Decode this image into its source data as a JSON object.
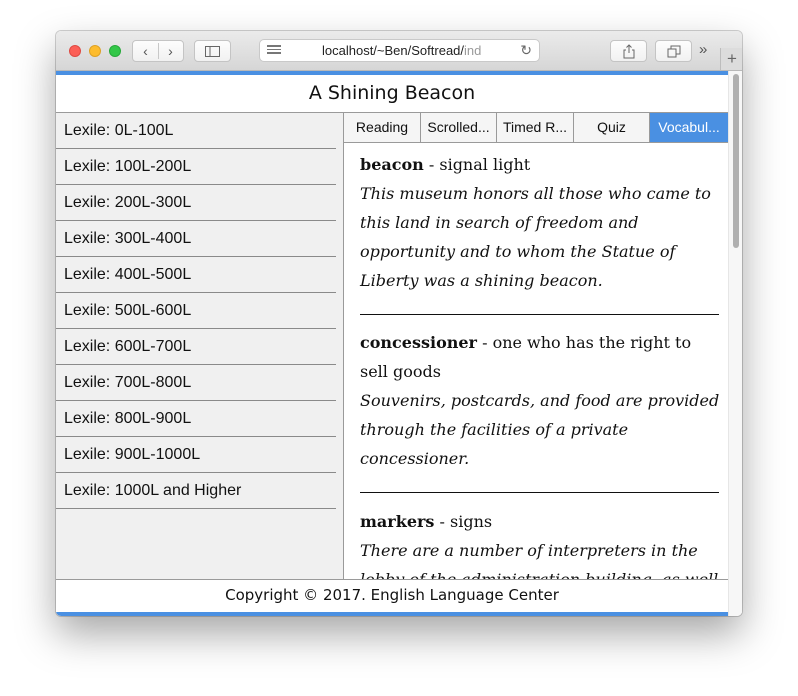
{
  "browser": {
    "url_text": "localhost/~Ben/Softread/",
    "url_faded": "ind"
  },
  "page": {
    "title": "A Shining Beacon",
    "footer": "Copyright © 2017. English Language Center"
  },
  "lexile_levels": [
    "Lexile: 0L-100L",
    "Lexile: 100L-200L",
    "Lexile: 200L-300L",
    "Lexile: 300L-400L",
    "Lexile: 400L-500L",
    "Lexile: 500L-600L",
    "Lexile: 600L-700L",
    "Lexile: 700L-800L",
    "Lexile: 800L-900L",
    "Lexile: 900L-1000L",
    "Lexile: 1000L and Higher"
  ],
  "tabs": [
    "Reading",
    "Scrolled...",
    "Timed R...",
    "Quiz",
    "Vocabul..."
  ],
  "active_tab": "Vocabul...",
  "vocabulary": [
    {
      "word": "beacon",
      "definition": " - signal light",
      "example": "This museum honors all those who came to this land in search of freedom and opportunity and to whom the Statue of Liberty was a shining beacon."
    },
    {
      "word": "concessioner",
      "definition": " - one who has the right to sell goods",
      "example": "Souvenirs, postcards, and food are provided through the facilities of a private concessioner."
    },
    {
      "word": "markers",
      "definition": " - signs",
      "example": "There are a number of interpreters in the lobby of the administration building, as well as"
    }
  ],
  "colors": {
    "accent": "#4a90e2",
    "sidebar_bg": "#f0f0f0"
  }
}
